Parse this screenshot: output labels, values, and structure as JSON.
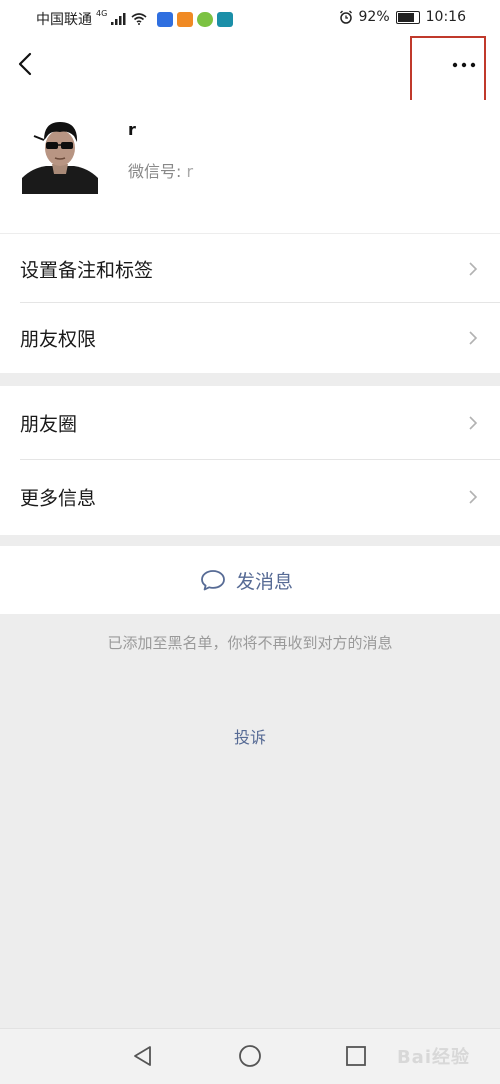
{
  "status_bar": {
    "carrier": "中国联通",
    "network": "4G",
    "battery_percent": "92%",
    "battery_level": 0.92,
    "time": "10:16",
    "app_icons": [
      {
        "name": "blue-app-icon",
        "color": "#2f6fe0"
      },
      {
        "name": "orange-app-icon",
        "color": "#f08a24"
      },
      {
        "name": "green-app-icon",
        "color": "#7cc242"
      },
      {
        "name": "teal-app-icon",
        "color": "#1b8fa8"
      }
    ]
  },
  "nav": {
    "back_icon": "chevron-left-icon",
    "more_icon": "more-dots-icon",
    "highlight_color": "#c0392b"
  },
  "profile": {
    "nickname": "r",
    "wechat_id_label": "微信号:",
    "wechat_id_value": "r"
  },
  "settings_group_1": [
    {
      "label": "设置备注和标签"
    },
    {
      "label": "朋友权限"
    }
  ],
  "settings_group_2": [
    {
      "label": "朋友圈"
    },
    {
      "label": "更多信息"
    }
  ],
  "send_message": {
    "label": "发消息",
    "icon": "chat-bubble-icon",
    "color": "#576b95"
  },
  "blacklist_notice": "已添加至黑名单，你将不再收到对方的消息",
  "report_link": "投诉",
  "watermark": "Bai经验",
  "system_nav": {
    "back": "triangle-back-icon",
    "home": "circle-home-icon",
    "recent": "square-recent-icon"
  }
}
